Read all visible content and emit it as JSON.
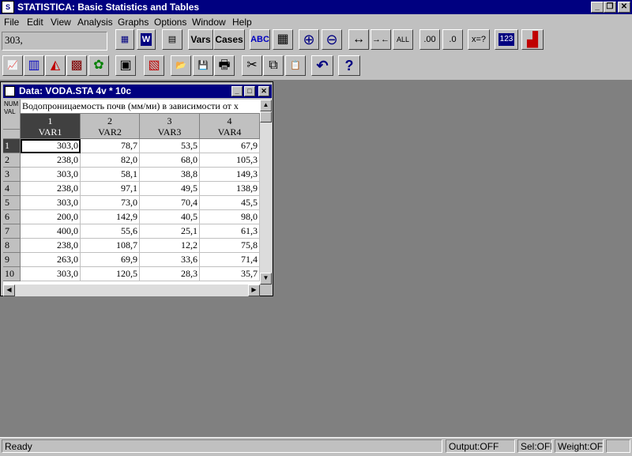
{
  "app": {
    "title": "STATISTICA: Basic Statistics and Tables",
    "icon_text": "S",
    "controls": {
      "minimize": "_",
      "restore": "❐",
      "close": "✕"
    }
  },
  "menu": [
    "File",
    "Edit",
    "View",
    "Analysis",
    "Graphs",
    "Options",
    "Window",
    "Help"
  ],
  "toolbar1": {
    "cell_value": "303,",
    "buttons": [
      {
        "name": "graphs-gallery",
        "glyph": "▦"
      },
      {
        "name": "workbook",
        "glyph": "W"
      },
      {
        "name": "spreadsheet",
        "glyph": "▤"
      },
      {
        "name": "vars",
        "text": "Vars"
      },
      {
        "name": "cases",
        "text": "Cases"
      },
      {
        "name": "abc-font",
        "glyph": "ABC"
      },
      {
        "name": "grid-lines",
        "glyph": "▦"
      },
      {
        "name": "zoom-in",
        "glyph": "⊕"
      },
      {
        "name": "zoom-out",
        "glyph": "⊖"
      },
      {
        "name": "widen-column",
        "glyph": "↔"
      },
      {
        "name": "narrow-column",
        "glyph": "→←"
      },
      {
        "name": "all-columns",
        "glyph": "ALL"
      },
      {
        "name": "increase-decimals",
        "glyph": ".00"
      },
      {
        "name": "decrease-decimals",
        "glyph": ".0"
      },
      {
        "name": "formula",
        "glyph": "x=?"
      },
      {
        "name": "abc123",
        "glyph": "123"
      },
      {
        "name": "bar-chart",
        "glyph": "▟"
      }
    ]
  },
  "toolbar2": {
    "buttons": [
      {
        "name": "chart-line",
        "glyph": "📈"
      },
      {
        "name": "chart-3d-bars",
        "glyph": "▥"
      },
      {
        "name": "chart-surface",
        "glyph": "◭"
      },
      {
        "name": "chart-matrix",
        "glyph": "▩"
      },
      {
        "name": "chart-icons",
        "glyph": "✿"
      },
      {
        "name": "chart-stats",
        "glyph": "▣"
      },
      {
        "name": "chart-custom",
        "glyph": "▧"
      },
      {
        "name": "open",
        "glyph": "📂"
      },
      {
        "name": "save",
        "glyph": "💾"
      },
      {
        "name": "print",
        "glyph": "🖶"
      },
      {
        "name": "cut",
        "glyph": "✂"
      },
      {
        "name": "copy",
        "glyph": "⧉"
      },
      {
        "name": "paste",
        "glyph": "📋"
      },
      {
        "name": "undo",
        "glyph": "↶"
      },
      {
        "name": "help",
        "glyph": "?"
      }
    ]
  },
  "datawin": {
    "title": "Data: VODA.STA 4v * 10c",
    "controls": {
      "minimize": "_",
      "maximize": "□",
      "close": "✕"
    },
    "numval": [
      "NUM",
      "VAL"
    ],
    "header_note": "Водопроницаемость почв (мм/ми) в зависимости от x",
    "columns": [
      {
        "num": "1",
        "name": "VAR1"
      },
      {
        "num": "2",
        "name": "VAR2"
      },
      {
        "num": "3",
        "name": "VAR3"
      },
      {
        "num": "4",
        "name": "VAR4"
      }
    ],
    "rows": [
      {
        "id": "1",
        "values": [
          "303,0",
          "78,7",
          "53,5",
          "67,9"
        ]
      },
      {
        "id": "2",
        "values": [
          "238,0",
          "82,0",
          "68,0",
          "105,3"
        ]
      },
      {
        "id": "3",
        "values": [
          "303,0",
          "58,1",
          "38,8",
          "149,3"
        ]
      },
      {
        "id": "4",
        "values": [
          "238,0",
          "97,1",
          "49,5",
          "138,9"
        ]
      },
      {
        "id": "5",
        "values": [
          "303,0",
          "73,0",
          "70,4",
          "45,5"
        ]
      },
      {
        "id": "6",
        "values": [
          "200,0",
          "142,9",
          "40,5",
          "98,0"
        ]
      },
      {
        "id": "7",
        "values": [
          "400,0",
          "55,6",
          "25,1",
          "61,3"
        ]
      },
      {
        "id": "8",
        "values": [
          "238,0",
          "108,7",
          "12,2",
          "75,8"
        ]
      },
      {
        "id": "9",
        "values": [
          "263,0",
          "69,9",
          "33,6",
          "71,4"
        ]
      },
      {
        "id": "10",
        "values": [
          "303,0",
          "120,5",
          "28,3",
          "35,7"
        ]
      }
    ]
  },
  "status": {
    "ready": "Ready",
    "output": "Output:OFF",
    "sel": "Sel:OFF",
    "weight": "Weight:OFF"
  }
}
